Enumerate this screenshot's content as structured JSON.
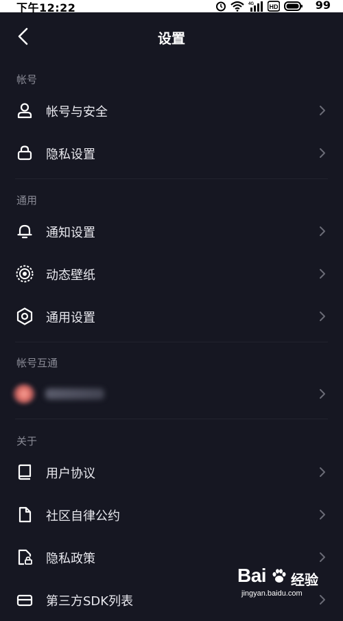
{
  "status_bar": {
    "time": "下午12:22",
    "battery": "99",
    "network_label": "4G",
    "hd_label": "HD"
  },
  "header": {
    "title": "设置",
    "back_icon": "chevron-left-icon"
  },
  "sections": [
    {
      "label": "帐号",
      "items": [
        {
          "label": "帐号与安全",
          "icon": "user-icon"
        },
        {
          "label": "隐私设置",
          "icon": "lock-icon"
        }
      ]
    },
    {
      "label": "通用",
      "items": [
        {
          "label": "通知设置",
          "icon": "bell-icon"
        },
        {
          "label": "动态壁纸",
          "icon": "live-wallpaper-icon"
        },
        {
          "label": "通用设置",
          "icon": "gear-icon"
        }
      ]
    },
    {
      "label": "帐号互通",
      "items": [
        {
          "label": "",
          "icon": "blurred-avatar-icon"
        }
      ]
    },
    {
      "label": "关于",
      "items": [
        {
          "label": "用户协议",
          "icon": "book-icon"
        },
        {
          "label": "社区自律公约",
          "icon": "document-icon"
        },
        {
          "label": "隐私政策",
          "icon": "privacy-lock-file-icon"
        },
        {
          "label": "第三方SDK列表",
          "icon": "card-stack-icon"
        }
      ]
    }
  ],
  "watermark": {
    "brand": "Bai",
    "brand_suffix": "经验",
    "url": "jingyan.baidu.com"
  },
  "colors": {
    "background": "#161722",
    "text_primary": "#e8e8ee",
    "text_secondary": "#8a8b96",
    "chevron": "#6a6b76"
  }
}
